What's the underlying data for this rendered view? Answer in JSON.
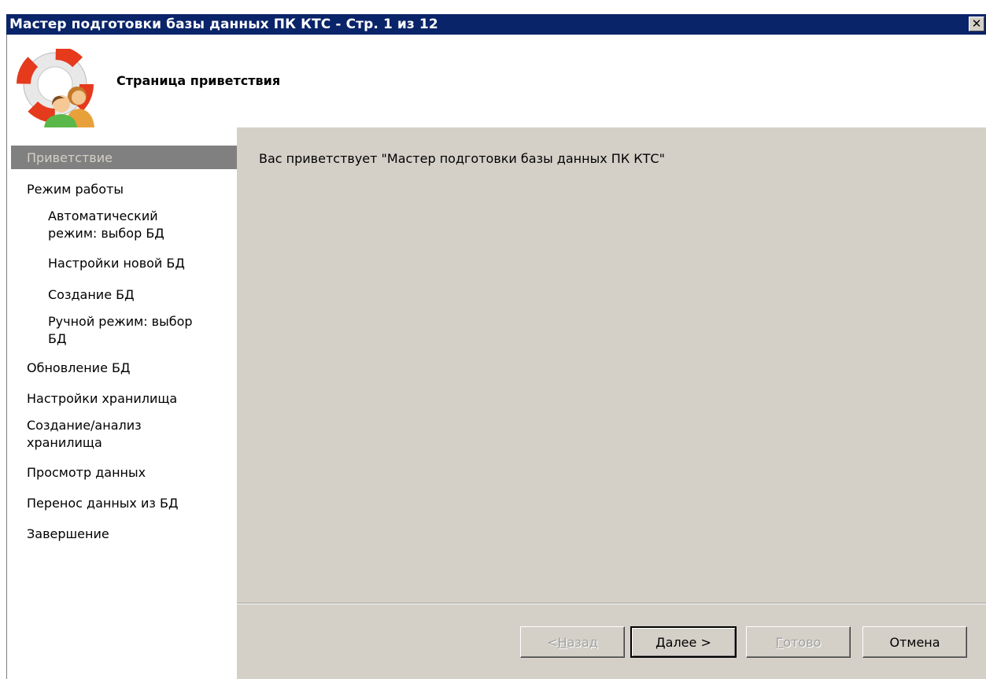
{
  "window": {
    "title": "Мастер подготовки базы данных ПК КТС - Стр. 1 из 12",
    "close_label": "✕"
  },
  "header": {
    "title": "Страница приветствия",
    "logo_icon": "lifebuoy-users-icon"
  },
  "sidebar": {
    "items": [
      {
        "label": "Приветствие",
        "active": true
      },
      {
        "label": "Режим работы"
      },
      {
        "label": "Автоматический режим: выбор БД"
      },
      {
        "label": "Настройки новой БД"
      },
      {
        "label": "Создание БД"
      },
      {
        "label": "Ручной режим: выбор БД"
      },
      {
        "label": "Обновление БД"
      },
      {
        "label": "Настройки хранилища"
      },
      {
        "label": "Создание/анализ хранилища"
      },
      {
        "label": "Просмотр данных"
      },
      {
        "label": "Перенос данных из БД"
      },
      {
        "label": "Завершение"
      }
    ]
  },
  "main": {
    "welcome_text": "Вас приветствует \"Мастер подготовки базы данных ПК КТС\""
  },
  "buttons": {
    "back": {
      "pre": "< ",
      "mnemonic": "Н",
      "post": "азад",
      "enabled": false
    },
    "next": {
      "pre": "",
      "mnemonic": "Д",
      "post": "алее >",
      "enabled": true
    },
    "finish": {
      "pre": "",
      "mnemonic": "Г",
      "post": "отово",
      "enabled": false
    },
    "cancel": {
      "label": "Отмена",
      "enabled": true
    }
  },
  "colors": {
    "titlebar": "#0a246a",
    "panel": "#d4d0c8",
    "active_item": "#808080"
  }
}
